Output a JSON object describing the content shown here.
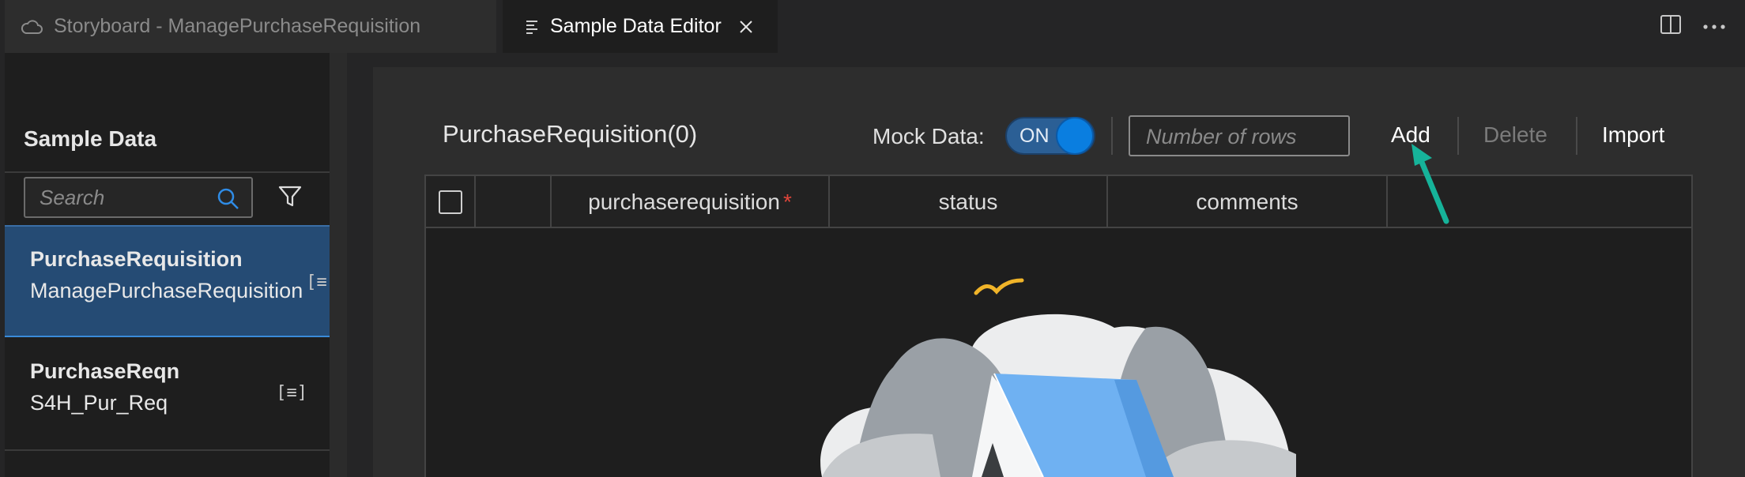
{
  "tabs": {
    "inactive": {
      "label": "Storyboard - ManagePurchaseRequisition",
      "icon": "cloud-icon"
    },
    "active": {
      "label": "Sample Data Editor",
      "icon": "document-lines-icon"
    }
  },
  "tab_actions": [
    "split-editor-icon",
    "more-actions-icon"
  ],
  "sidebar": {
    "title": "Sample Data",
    "search_placeholder": "Search",
    "items": [
      {
        "title": "PurchaseRequisition",
        "subtitle": "ManagePurchaseRequisition",
        "icon": "[≡]",
        "selected": true
      },
      {
        "title": "PurchaseReqn",
        "subtitle": "S4H_Pur_Req",
        "icon": "[≡]",
        "selected": false
      }
    ]
  },
  "editor": {
    "entity_title": "PurchaseRequisition(0)",
    "mock_data_label": "Mock Data:",
    "mock_toggle": "ON",
    "rows_placeholder": "Number of rows",
    "add_label": "Add",
    "delete_label": "Delete",
    "import_label": "Import",
    "columns": [
      "purchaserequisition",
      "status",
      "comments"
    ],
    "required_marker": "*"
  },
  "colors": {
    "accent": "#0a7ee0",
    "selection": "#254b74",
    "annotation_arrow": "#16b39a",
    "required": "#e0453a"
  }
}
